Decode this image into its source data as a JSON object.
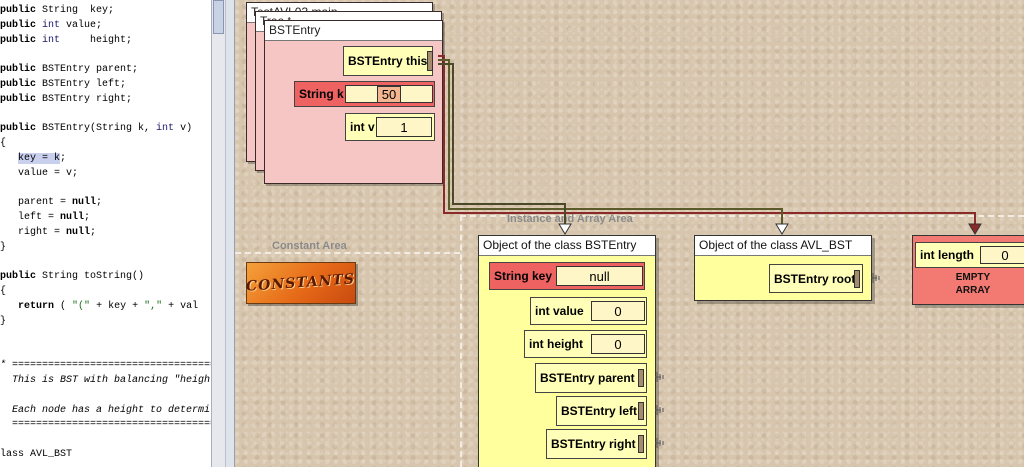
{
  "code": {
    "lines": [
      [
        {
          "t": "public",
          "c": "kw"
        },
        {
          "t": " String  key;",
          "c": ""
        }
      ],
      [
        {
          "t": "public",
          "c": "kw"
        },
        {
          "t": " int",
          "c": "ty"
        },
        {
          "t": " value;",
          "c": ""
        }
      ],
      [
        {
          "t": "public",
          "c": "kw"
        },
        {
          "t": " int",
          "c": "ty"
        },
        {
          "t": "     height;",
          "c": ""
        }
      ],
      [],
      [
        {
          "t": "public",
          "c": "kw"
        },
        {
          "t": " BSTEntry parent;",
          "c": ""
        }
      ],
      [
        {
          "t": "public",
          "c": "kw"
        },
        {
          "t": " BSTEntry left;",
          "c": ""
        }
      ],
      [
        {
          "t": "public",
          "c": "kw"
        },
        {
          "t": " BSTEntry right;",
          "c": ""
        }
      ],
      [],
      [
        {
          "t": "public",
          "c": "kw"
        },
        {
          "t": " BSTEntry(String k, ",
          "c": ""
        },
        {
          "t": "int",
          "c": "ty"
        },
        {
          "t": " v)",
          "c": ""
        }
      ],
      [
        {
          "t": "{",
          "c": ""
        }
      ],
      [
        {
          "t": "   ",
          "c": ""
        },
        {
          "t": "key = k",
          "c": "hl"
        },
        {
          "t": ";",
          "c": ""
        }
      ],
      [
        {
          "t": "   value = v;",
          "c": ""
        }
      ],
      [],
      [
        {
          "t": "   parent = ",
          "c": ""
        },
        {
          "t": "null",
          "c": "kw"
        },
        {
          "t": ";",
          "c": ""
        }
      ],
      [
        {
          "t": "   left = ",
          "c": ""
        },
        {
          "t": "null",
          "c": "kw"
        },
        {
          "t": ";",
          "c": ""
        }
      ],
      [
        {
          "t": "   right = ",
          "c": ""
        },
        {
          "t": "null",
          "c": "kw"
        },
        {
          "t": ";",
          "c": ""
        }
      ],
      [
        {
          "t": "}",
          "c": ""
        }
      ],
      [],
      [
        {
          "t": "public",
          "c": "kw"
        },
        {
          "t": " String toString()",
          "c": ""
        }
      ],
      [
        {
          "t": "{",
          "c": ""
        }
      ],
      [
        {
          "t": "   ",
          "c": ""
        },
        {
          "t": "return",
          "c": "kw"
        },
        {
          "t": " ( ",
          "c": ""
        },
        {
          "t": "\"(\"",
          "c": "str"
        },
        {
          "t": " + key + ",
          "c": ""
        },
        {
          "t": "\",\"",
          "c": "str"
        },
        {
          "t": " + val",
          "c": ""
        }
      ],
      [
        {
          "t": "}",
          "c": ""
        }
      ],
      [],
      [],
      [
        {
          "t": "* ==========================================",
          "c": "cmt"
        }
      ],
      [
        {
          "t": "  This is BST with balancing \"heigh",
          "c": "cmt"
        }
      ],
      [],
      [
        {
          "t": "  Each node has a height to determi",
          "c": "cmt"
        }
      ],
      [
        {
          "t": "  ==========================================",
          "c": "cmt"
        }
      ],
      [],
      [
        {
          "t": "lass AVL_BST",
          "c": ""
        }
      ]
    ]
  },
  "canvas": {
    "constant_area_label": "Constant Area",
    "instance_area_label": "Instance and Array Area",
    "constants_badge": "CONSTANTS"
  },
  "frames": {
    "back2_title": "TestAVL03.main",
    "back1_title": "Tree.t",
    "top_title": "BSTEntry",
    "this_label": "BSTEntry this",
    "k_label": "String k",
    "k_value": "50",
    "v_label": "int v",
    "v_value": "1"
  },
  "bst_object": {
    "title": "Object of the class BSTEntry",
    "key_label": "String key",
    "key_value": "null",
    "value_label": "int value",
    "value_value": "0",
    "height_label": "int height",
    "height_value": "0",
    "parent_label": "BSTEntry parent",
    "left_label": "BSTEntry left",
    "right_label": "BSTEntry right"
  },
  "avl_object": {
    "title": "Object of the class AVL_BST",
    "root_label": "BSTEntry root"
  },
  "array_object": {
    "length_label": "int length",
    "length_value": "0",
    "empty_line1": "EMPTY",
    "empty_line2": "ARRAY"
  },
  "colors": {
    "frame_pink": "#f6c6c4",
    "object_yellow": "#ffff9e",
    "slot_red": "#ef6262",
    "array_red": "#f27a72",
    "arrow_red": "#8a2a2a",
    "arrow_olive": "#5a5a2a"
  }
}
